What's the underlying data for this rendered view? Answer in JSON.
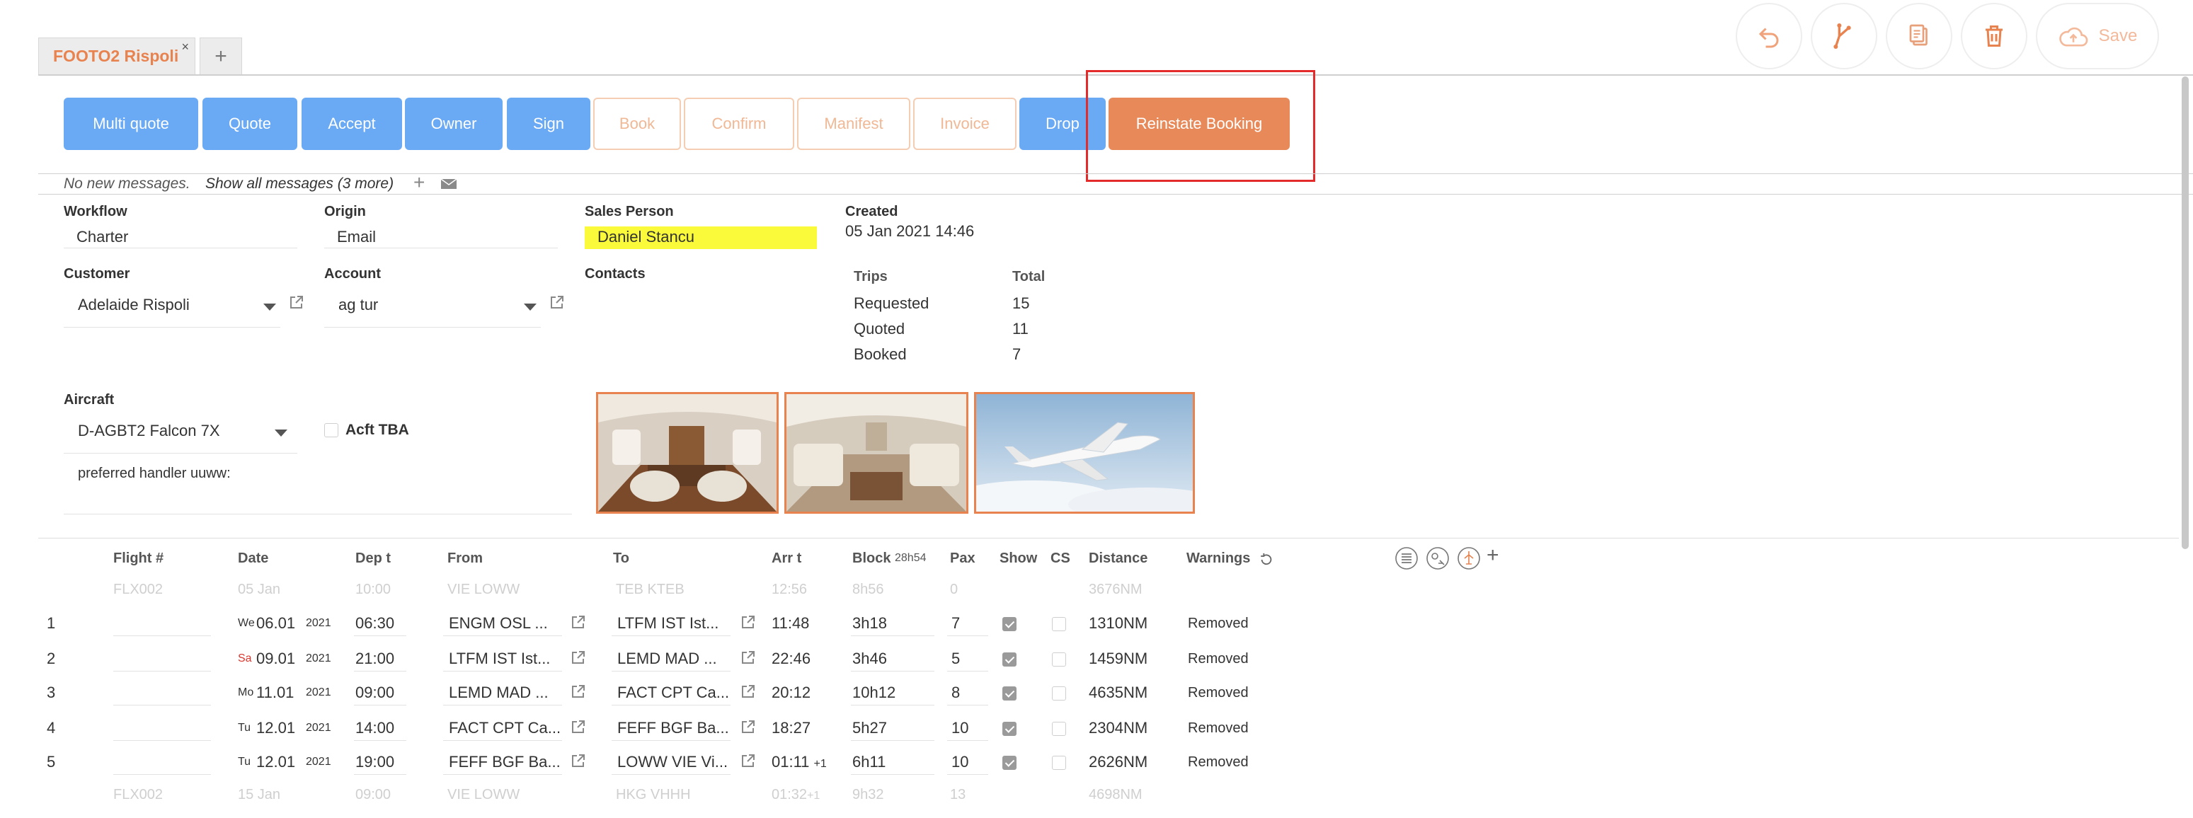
{
  "tabs": [
    {
      "label": "FOOTO2 Rispoli",
      "close": "×"
    }
  ],
  "tab_add": "+",
  "top_actions": {
    "undo": "undo-icon",
    "branch": "branch-icon",
    "copy": "copy-icon",
    "delete": "trash-icon",
    "save_label": "Save"
  },
  "buttons": [
    {
      "label": "Multi quote",
      "style": "blue"
    },
    {
      "label": "Quote",
      "style": "blue"
    },
    {
      "label": "Accept",
      "style": "blue"
    },
    {
      "label": "Owner",
      "style": "blue"
    },
    {
      "label": "Sign",
      "style": "blue"
    },
    {
      "label": "Book",
      "style": "outline"
    },
    {
      "label": "Confirm",
      "style": "outline"
    },
    {
      "label": "Manifest",
      "style": "outline"
    },
    {
      "label": "Invoice",
      "style": "outline"
    },
    {
      "label": "Drop",
      "style": "blue"
    },
    {
      "label": "Reinstate Booking",
      "style": "orange"
    }
  ],
  "messages": {
    "none": "No new messages.",
    "show_all": "Show all messages (3 more)",
    "add": "+"
  },
  "form": {
    "workflow_label": "Workflow",
    "workflow_value": "Charter",
    "origin_label": "Origin",
    "origin_value": "Email",
    "sales_label": "Sales Person",
    "sales_value": "Daniel Stancu",
    "created_label": "Created",
    "created_value": "05 Jan 2021 14:46",
    "customer_label": "Customer",
    "customer_value": "Adelaide Rispoli",
    "account_label": "Account",
    "account_value": "ag tur",
    "contacts_label": "Contacts",
    "aircraft_label": "Aircraft",
    "aircraft_value": "D-AGBT2 Falcon 7X",
    "acft_tba_label": "Acft TBA",
    "notes": "preferred handler uuww:"
  },
  "trips": {
    "header_trips": "Trips",
    "header_total": "Total",
    "rows": [
      {
        "label": "Requested",
        "value": "15"
      },
      {
        "label": "Quoted",
        "value": "11"
      },
      {
        "label": "Booked",
        "value": "7"
      }
    ]
  },
  "thumbnails": [
    "cabin-photo",
    "cabin-photo",
    "jet-photo"
  ],
  "table": {
    "headers": {
      "flight": "Flight #",
      "date": "Date",
      "dep": "Dep t",
      "from": "From",
      "to": "To",
      "arr": "Arr t",
      "block": "Block",
      "block_total": "28h54",
      "pax": "Pax",
      "show": "Show",
      "cs": "CS",
      "distance": "Distance",
      "warnings": "Warnings",
      "add": "+"
    },
    "ghost_top": {
      "flight": "FLX002",
      "date": "05 Jan",
      "dep": "10:00",
      "from": "VIE LOWW",
      "to": "TEB KTEB",
      "arr": "12:56",
      "block": "8h56",
      "pax": "0",
      "distance": "3676NM"
    },
    "rows": [
      {
        "num": "1",
        "dow": "We",
        "date": "06.01",
        "year": "2021",
        "dep": "06:30",
        "from": "ENGM OSL ...",
        "to": "LTFM IST Ist...",
        "arr": "11:48",
        "arr_suffix": "",
        "block": "3h18",
        "pax": "7",
        "show": true,
        "cs": false,
        "distance": "1310NM",
        "warning": "Removed"
      },
      {
        "num": "2",
        "dow": "Sa",
        "date": "09.01",
        "year": "2021",
        "dep": "21:00",
        "from": "LTFM IST Ist...",
        "to": "LEMD MAD ...",
        "arr": "22:46",
        "arr_suffix": "",
        "block": "3h46",
        "pax": "5",
        "show": true,
        "cs": false,
        "distance": "1459NM",
        "warning": "Removed"
      },
      {
        "num": "3",
        "dow": "Mo",
        "date": "11.01",
        "year": "2021",
        "dep": "09:00",
        "from": "LEMD MAD ...",
        "to": "FACT CPT Ca...",
        "arr": "20:12",
        "arr_suffix": "",
        "block": "10h12",
        "pax": "8",
        "show": true,
        "cs": false,
        "distance": "4635NM",
        "warning": "Removed"
      },
      {
        "num": "4",
        "dow": "Tu",
        "date": "12.01",
        "year": "2021",
        "dep": "14:00",
        "from": "FACT CPT Ca...",
        "to": "FEFF BGF Ba...",
        "arr": "18:27",
        "arr_suffix": "",
        "block": "5h27",
        "pax": "10",
        "show": true,
        "cs": false,
        "distance": "2304NM",
        "warning": "Removed"
      },
      {
        "num": "5",
        "dow": "Tu",
        "date": "12.01",
        "year": "2021",
        "dep": "19:00",
        "from": "FEFF BGF Ba...",
        "to": "LOWW VIE Vi...",
        "arr": "01:11",
        "arr_suffix": "+1",
        "block": "6h11",
        "pax": "10",
        "show": true,
        "cs": false,
        "distance": "2626NM",
        "warning": "Removed"
      }
    ],
    "ghost_bottom": {
      "flight": "FLX002",
      "date": "15 Jan",
      "dep": "09:00",
      "from": "VIE LOWW",
      "to": "HKG VHHH",
      "arr": "01:32",
      "arr_suffix": "+1",
      "block": "9h32",
      "pax": "13",
      "distance": "4698NM"
    }
  },
  "colors": {
    "accent": "#e8824e",
    "blue": "#6aa9f4",
    "highlight": "#fafa3a",
    "red_box": "#e32b2b"
  }
}
